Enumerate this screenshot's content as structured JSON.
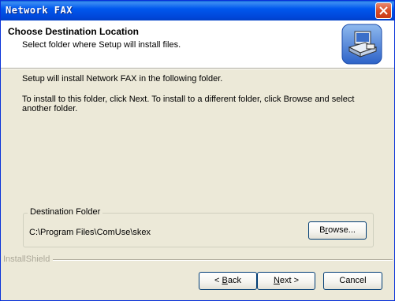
{
  "window": {
    "title": "Network FAX",
    "close_icon": "close-x-icon"
  },
  "header": {
    "title": "Choose Destination Location",
    "subtitle": "Select folder where Setup will install files.",
    "icon": "computer-install-icon"
  },
  "body": {
    "line1": "Setup will install Network FAX in the following folder.",
    "line2a": "To install to this folder, click Next. To install to a different folder, click Browse and select",
    "line2b": "another folder."
  },
  "destination": {
    "group_label": "Destination Folder",
    "path": "C:\\Program Files\\ComUse\\skex",
    "browse_label_pre": "B",
    "browse_label_u": "r",
    "browse_label_post": "owse..."
  },
  "footer": {
    "brand": "InstallShield",
    "back_pre": "< ",
    "back_u": "B",
    "back_post": "ack",
    "next_u": "N",
    "next_post": "ext >",
    "cancel_label": "Cancel"
  }
}
